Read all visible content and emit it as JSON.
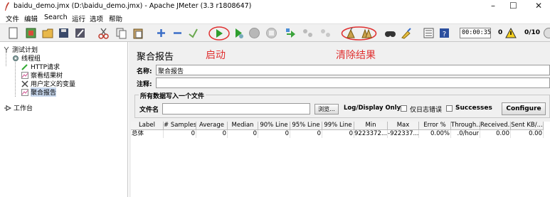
{
  "window": {
    "title": "baidu_demo.jmx (D:\\baidu_demo.jmx) - Apache JMeter (3.3 r1808647)",
    "minimize": "–",
    "maximize": "☐",
    "close": "✕"
  },
  "menu": [
    "文件",
    "编辑",
    "Search",
    "运行",
    "选项",
    "帮助"
  ],
  "toolbar": {
    "timer": "00:00:35",
    "active_threads": "0",
    "thread_ratio": "0/10"
  },
  "tree": {
    "test_plan": "测试计划",
    "thread_group": "线程组",
    "http_request": "HTTP请求",
    "view_results": "察看结果树",
    "user_vars": "用户定义的变量",
    "aggregate_report": "聚合报告",
    "workbench": "工作台"
  },
  "panel": {
    "title": "聚合报告",
    "annotation_start": "启动",
    "annotation_clear": "清除结果",
    "name_label": "名称:",
    "name_value": "聚合报告",
    "comment_label": "注释:",
    "comment_value": "",
    "write_legend": "所有数据写入一个文件",
    "filename_label": "文件名",
    "filename_value": "",
    "browse_button": "浏览...",
    "log_display_label": "Log/Display Only:",
    "errors_only_label": "仅日志错误",
    "successes_label": "Successes",
    "configure_button": "Configure"
  },
  "table": {
    "headers": [
      "Label",
      "# Samples",
      "Average",
      "Median",
      "90% Line",
      "95% Line",
      "99% Line",
      "Min",
      "Max",
      "Error %",
      "Through...",
      "Received...",
      "Sent KB/..."
    ],
    "rows": [
      [
        "总体",
        "0",
        "0",
        "0",
        "0",
        "0",
        "0",
        "9223372...",
        "-922337...",
        "0.00%",
        ".0/hour",
        "0.00",
        "0.00"
      ]
    ]
  }
}
